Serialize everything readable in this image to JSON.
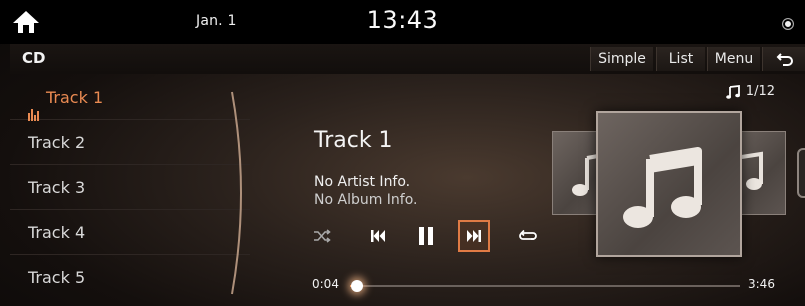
{
  "status_bar": {
    "date": "Jan. 1",
    "time": "13:43"
  },
  "header": {
    "source_title": "CD",
    "buttons": {
      "simple": "Simple",
      "list": "List",
      "menu": "Menu"
    }
  },
  "track_list": {
    "items": [
      {
        "label": "Track 1",
        "active": true
      },
      {
        "label": "Track 2"
      },
      {
        "label": "Track 3"
      },
      {
        "label": "Track 4"
      },
      {
        "label": "Track 5"
      }
    ]
  },
  "now_playing": {
    "title": "Track 1",
    "artist": "No Artist Info.",
    "album": "No Album Info.",
    "track_count": "1/12"
  },
  "progress": {
    "elapsed": "0:04",
    "total": "3:46",
    "fraction": 0.018
  },
  "colors": {
    "accent": "#e98a52",
    "highlight_border": "#e07b45"
  },
  "icons": [
    "home-icon",
    "music-note-icon",
    "shuffle-icon",
    "previous-track-icon",
    "pause-icon",
    "next-track-icon",
    "repeat-icon",
    "back-arrow-icon",
    "equalizer-icon"
  ]
}
